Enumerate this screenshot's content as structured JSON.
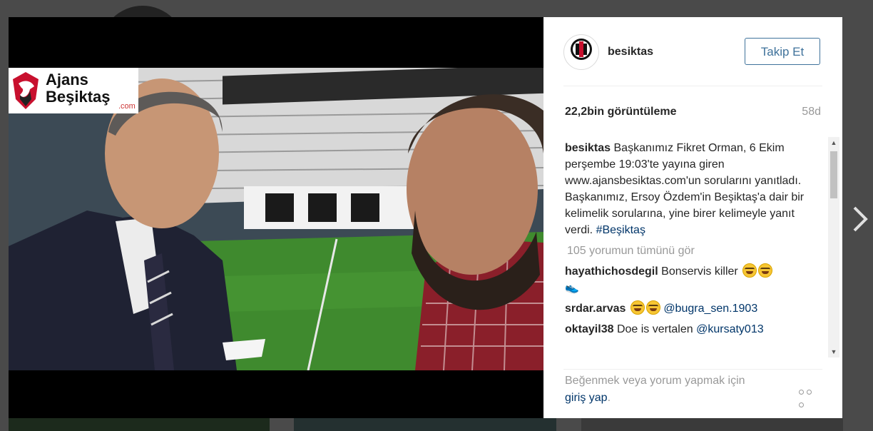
{
  "post": {
    "username": "besiktas",
    "follow_label": "Takip Et",
    "views": "22,2bin görüntüleme",
    "time_ago": "58d",
    "logo": {
      "line1": "Ajans",
      "line2": "Beşiktaş",
      "suffix": ".com"
    },
    "avatar_caption": "Beşiktaş JK"
  },
  "caption": {
    "author": "besiktas",
    "text": "Başkanımız Fikret Orman, 6 Ekim perşembe 19:03'te yayına giren www.ajansbesiktas.com'un sorularını yanıtladı. Başkanımız, Ersoy Özdem'in Beşiktaş'a dair bir kelimelik sorularına, yine birer kelimeyle yanıt verdi. ",
    "hashtag": "#Beşiktaş"
  },
  "view_all": "105 yorumun tümünü gör",
  "comments": [
    {
      "user": "hayathichosdegil",
      "text": "Bonservis killer",
      "emoji_count": 2,
      "extra_emoji": "👟"
    },
    {
      "user": "srdar.arvas",
      "text": "",
      "emoji_count": 2,
      "mention": "@bugra_sen.1903"
    },
    {
      "user": "oktayil38",
      "text": "Doe is vertalen",
      "emoji_count": 0,
      "mention": "@kursaty013"
    }
  ],
  "footer": {
    "login_text": "Beğenmek veya yorum yapmak için",
    "login_link": "giriş yap",
    "login_suffix": "."
  },
  "colors": {
    "follow_border": "#3f729b",
    "link": "#003569",
    "muted": "#999999",
    "overlay": "#4a4a4a"
  },
  "icons": {
    "next": "chevron-right-icon",
    "more": "more-options-icon",
    "scroll_up": "scroll-up-arrow-icon",
    "scroll_down": "scroll-down-arrow-icon"
  }
}
